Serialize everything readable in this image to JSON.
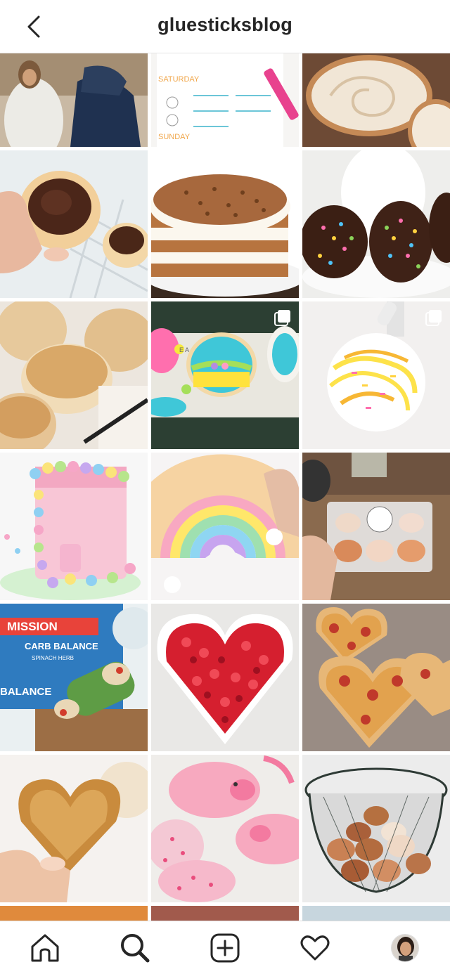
{
  "header": {
    "title": "gluesticksblog",
    "back_icon": "chevron-left-icon"
  },
  "grid": {
    "posts": [
      {
        "name": "post-jesus-painting",
        "multi": false
      },
      {
        "name": "post-easter-worksheet",
        "multi": false
      },
      {
        "name": "post-sliced-bread",
        "multi": false
      },
      {
        "name": "post-chocolate-frosted-cookie",
        "multi": false
      },
      {
        "name": "post-carrot-cake",
        "multi": false
      },
      {
        "name": "post-chocolate-eggs-sprinkles",
        "multi": false
      },
      {
        "name": "post-biscuits",
        "multi": false
      },
      {
        "name": "post-easter-egg-cookies",
        "multi": true
      },
      {
        "name": "post-cake-pop-drizzle",
        "multi": true
      },
      {
        "name": "post-candy-cake-tower",
        "multi": false
      },
      {
        "name": "post-rainbow-cookie",
        "multi": false
      },
      {
        "name": "post-fresh-eggs-carton",
        "multi": false
      },
      {
        "name": "post-mission-tortilla-wraps",
        "multi": false
      },
      {
        "name": "post-heart-strawberries",
        "multi": false
      },
      {
        "name": "post-heart-pizzas",
        "multi": false
      },
      {
        "name": "post-heart-roll",
        "multi": false
      },
      {
        "name": "post-pig-cookies",
        "multi": false
      },
      {
        "name": "post-egg-basket",
        "multi": false
      }
    ]
  },
  "tabbar": {
    "items": [
      "home-icon",
      "search-icon",
      "new-post-icon",
      "heart-icon",
      "profile-avatar"
    ]
  },
  "colors": {
    "text": "#262626",
    "border": "#dbdbdb"
  }
}
